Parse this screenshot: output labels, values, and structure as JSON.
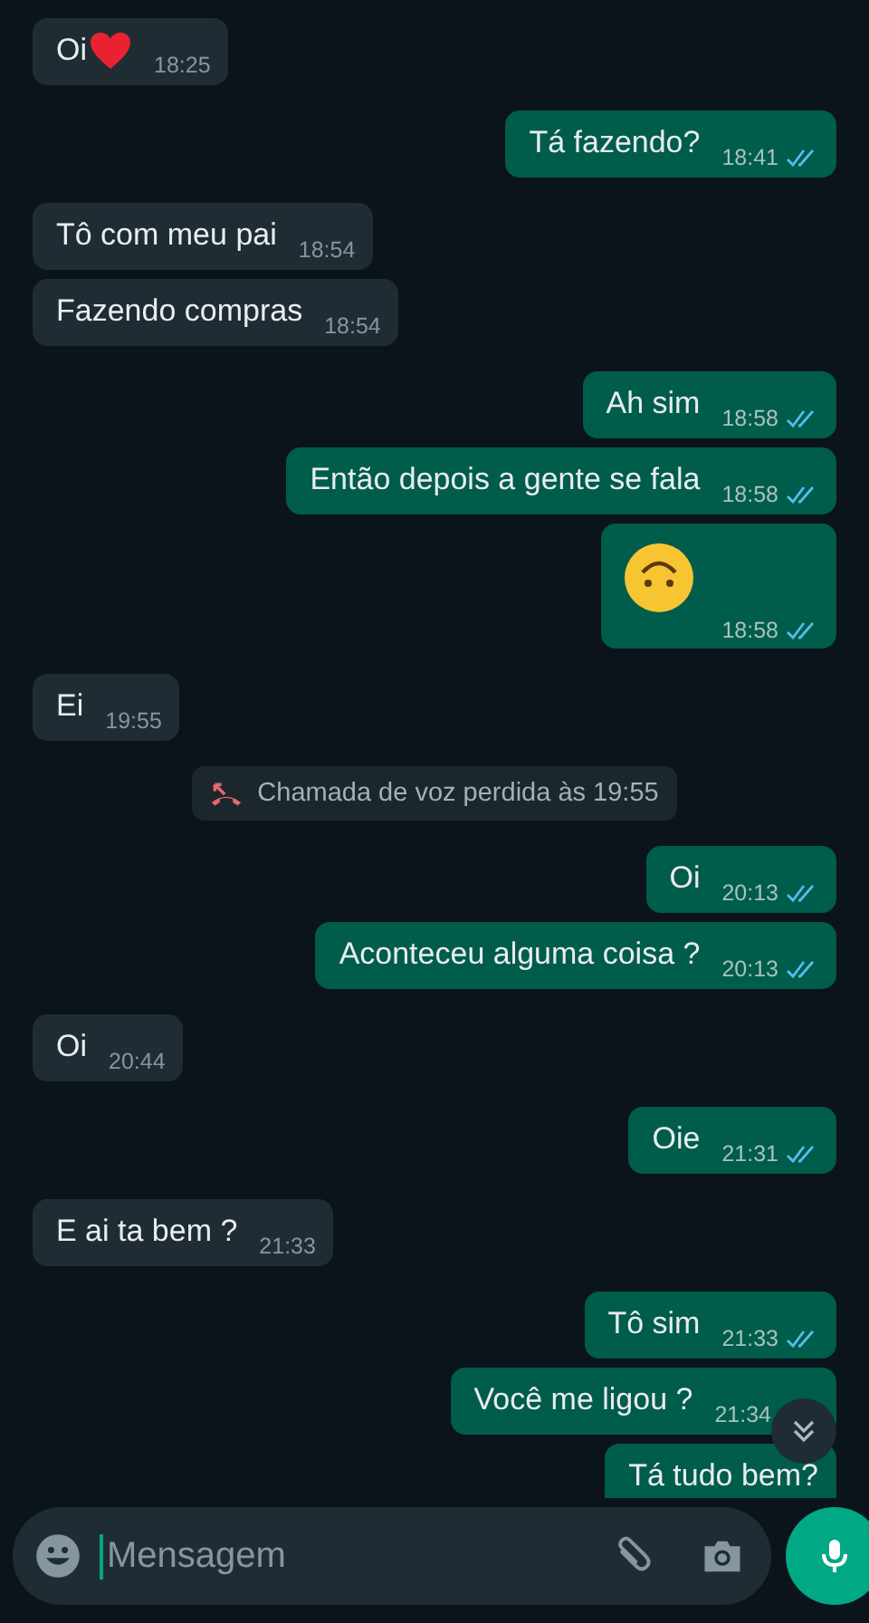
{
  "messages": [
    {
      "kind": "text_heart",
      "outgoing": false,
      "text": "Oi",
      "time": "18:25"
    },
    {
      "kind": "text",
      "outgoing": true,
      "text": "Tá fazendo?",
      "time": "18:41",
      "read": true
    },
    {
      "kind": "text",
      "outgoing": false,
      "text": "Tô com meu pai",
      "time": "18:54"
    },
    {
      "kind": "text",
      "outgoing": false,
      "text": "Fazendo compras",
      "time": "18:54"
    },
    {
      "kind": "text",
      "outgoing": true,
      "text": "Ah sim",
      "time": "18:58",
      "read": true
    },
    {
      "kind": "text",
      "outgoing": true,
      "text": "Então depois a gente se fala",
      "time": "18:58",
      "read": true
    },
    {
      "kind": "emoji",
      "outgoing": true,
      "time": "18:58",
      "read": true
    },
    {
      "kind": "text",
      "outgoing": false,
      "text": "Ei",
      "time": "19:55"
    },
    {
      "kind": "missed_call",
      "text": "Chamada de voz perdida às 19:55"
    },
    {
      "kind": "text",
      "outgoing": true,
      "text": "Oi",
      "time": "20:13",
      "read": true
    },
    {
      "kind": "text",
      "outgoing": true,
      "text": "Aconteceu alguma coisa ?",
      "time": "20:13",
      "read": true
    },
    {
      "kind": "text",
      "outgoing": false,
      "text": "Oi",
      "time": "20:44"
    },
    {
      "kind": "text",
      "outgoing": true,
      "text": "Oie",
      "time": "21:31",
      "read": true
    },
    {
      "kind": "text",
      "outgoing": false,
      "text": "E ai ta bem  ?",
      "time": "21:33"
    },
    {
      "kind": "text",
      "outgoing": true,
      "text": "Tô sim",
      "time": "21:33",
      "read": true
    },
    {
      "kind": "text",
      "outgoing": true,
      "text": "Você me ligou ?",
      "time": "21:34"
    },
    {
      "kind": "text",
      "outgoing": true,
      "text": "Tá tudo bem?"
    }
  ],
  "composer": {
    "placeholder": "Mensagem"
  }
}
